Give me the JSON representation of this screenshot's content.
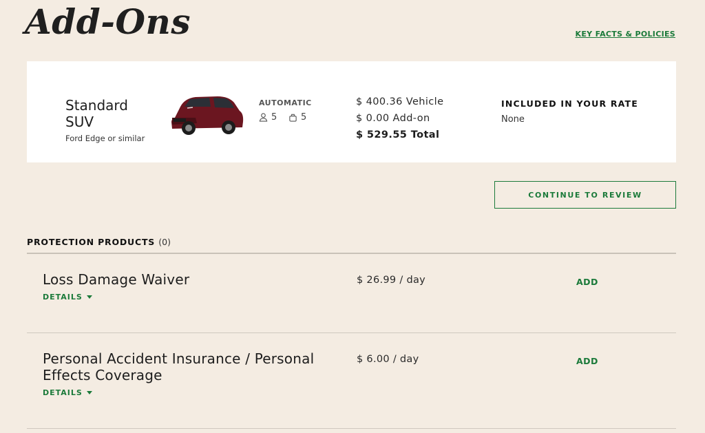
{
  "page": {
    "title": "Add-Ons",
    "key_facts_link": "KEY FACTS & POLICIES"
  },
  "vehicle": {
    "name": "Standard SUV",
    "subtitle": "Ford Edge or similar",
    "transmission": "AUTOMATIC",
    "passengers": "5",
    "bags": "5",
    "price_vehicle": "$ 400.36 Vehicle",
    "price_addon": "$ 0.00 Add-on",
    "price_total": "$ 529.55 Total",
    "included_heading": "INCLUDED IN YOUR RATE",
    "included_value": "None"
  },
  "actions": {
    "continue_label": "CONTINUE TO REVIEW"
  },
  "protection": {
    "heading": "PROTECTION PRODUCTS",
    "count": "(0)",
    "products": [
      {
        "name": "Loss Damage Waiver",
        "price": "$ 26.99 / day",
        "add_label": "ADD",
        "details_label": "DETAILS"
      },
      {
        "name": "Personal Accident Insurance / Personal Effects Coverage",
        "price": "$ 6.00 / day",
        "add_label": "ADD",
        "details_label": "DETAILS"
      }
    ]
  },
  "colors": {
    "background": "#f4ece2",
    "accent_green": "#1b7a3a",
    "card": "#ffffff",
    "car_body": "#6b1620"
  }
}
